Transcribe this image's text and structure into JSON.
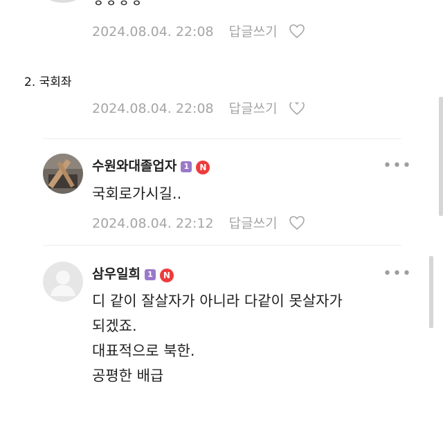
{
  "top_comment": {
    "cut_text": "ㅎㅎㅎㅎ",
    "timestamp": "2024.08.04. 22:08",
    "reply_label": "답글쓰기"
  },
  "section": {
    "title": "2. 국회좌"
  },
  "second_cut_comment": {
    "timestamp": "2024.08.04. 22:08",
    "reply_label": "답글쓰기"
  },
  "comments": [
    {
      "author": "수원와대졸업자",
      "level_badge": "1",
      "n_badge": "N",
      "more": "•••",
      "lines": [
        "국회로가시길.."
      ],
      "timestamp": "2024.08.04. 22:12",
      "reply_label": "답글쓰기"
    },
    {
      "author": "삼우일희",
      "level_badge": "1",
      "n_badge": "N",
      "more": "•••",
      "lines": [
        "디 같이 잘살자가 아니라 다같이 못살자가",
        "되겠죠.",
        "대표적으로 북한.",
        "공평한 배급"
      ]
    }
  ],
  "colors": {
    "meta_gray": "#a5a5a5",
    "level_purple": "#9a79c9",
    "n_red": "#ee3b3b"
  }
}
